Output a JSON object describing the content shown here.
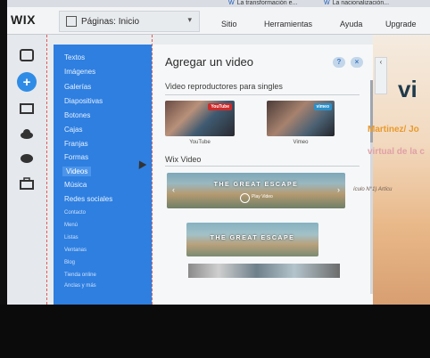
{
  "browser_tabs": [
    {
      "label": "La transformación e..."
    },
    {
      "label": "La nacionalización..."
    }
  ],
  "topbar": {
    "logo": "WIX",
    "pages_dropdown": "Páginas: Inicio",
    "menu": [
      "Sitio",
      "Herramientas",
      "Ayuda",
      "Upgrade"
    ]
  },
  "categories": [
    {
      "label": "Textos"
    },
    {
      "label": "Imágenes"
    },
    {
      "label": "Galerías"
    },
    {
      "label": "Diapositivas"
    },
    {
      "label": "Botones"
    },
    {
      "label": "Cajas"
    },
    {
      "label": "Franjas"
    },
    {
      "label": "Formas"
    },
    {
      "label": "Videos"
    },
    {
      "label": "Música"
    },
    {
      "label": "Redes sociales"
    },
    {
      "label": "Contacto"
    },
    {
      "label": "Menú"
    },
    {
      "label": "Listas"
    },
    {
      "label": "Ventanas"
    },
    {
      "label": "Blog"
    },
    {
      "label": "Tienda online"
    },
    {
      "label": "Anclas y más"
    }
  ],
  "panel": {
    "title": "Agregar un video",
    "help_label": "?",
    "close_label": "×",
    "section1": "Video reproductores para singles",
    "youtube_label": "YouTube",
    "youtube_badge": "YouTube",
    "vimeo_label": "Vimeo",
    "vimeo_badge": "vimeo",
    "section2": "Wix Video",
    "escape_title": "THE GREAT ESCAPE",
    "play_label": "Play Video"
  },
  "site": {
    "big_text": "vi",
    "name_text": "Martinez/ Jo",
    "orange_text": "virtual de la c",
    "small_text": "ículo N°1)   Artícu"
  },
  "colors": {
    "category_panel": "#2e7fe0",
    "add_button": "#2f8ce6",
    "site_accent": "#e99a2c"
  }
}
